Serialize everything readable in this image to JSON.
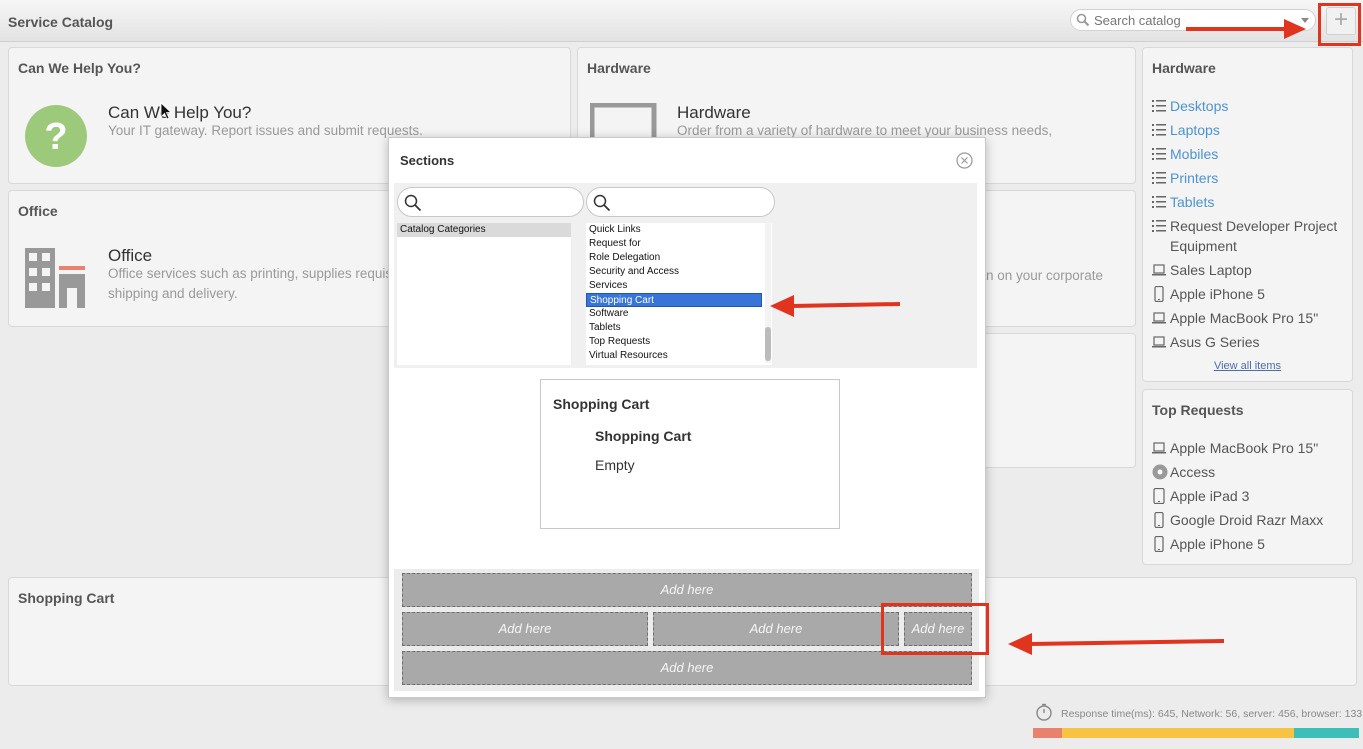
{
  "app": {
    "title": "Service Catalog",
    "search_placeholder": "Search catalog"
  },
  "widgets": {
    "help": {
      "title": "Can We Help You?",
      "heading": "Can We Help You?",
      "desc": "Your IT gateway. Report issues and submit requests."
    },
    "hardware": {
      "title": "Hardware",
      "heading": "Hardware",
      "desc": "Order from a variety of hardware to meet your business needs,"
    },
    "office": {
      "title": "Office",
      "heading": "Office",
      "desc_line1": "Office services such as printing, supplies requis",
      "desc_line2": "shipping and delivery."
    },
    "right_fragment": "n on your corporate",
    "shopping_cart": {
      "title": "Shopping Cart"
    }
  },
  "hardware_side": {
    "title": "Hardware",
    "items": [
      {
        "label": "Desktops",
        "icon": "list-icon",
        "link": true
      },
      {
        "label": "Laptops",
        "icon": "list-icon",
        "link": true
      },
      {
        "label": "Mobiles",
        "icon": "list-icon",
        "link": true
      },
      {
        "label": "Printers",
        "icon": "list-icon",
        "link": true
      },
      {
        "label": "Tablets",
        "icon": "list-icon",
        "link": true
      },
      {
        "label": "Request Developer Project Equipment",
        "icon": "list-icon",
        "link": false
      },
      {
        "label": "Sales Laptop",
        "icon": "laptop-icon",
        "link": false
      },
      {
        "label": "Apple iPhone 5",
        "icon": "phone-icon",
        "link": false
      },
      {
        "label": "Apple MacBook Pro 15\"",
        "icon": "laptop-icon",
        "link": false
      },
      {
        "label": "Asus G Series",
        "icon": "laptop-icon",
        "link": false
      }
    ],
    "view_all": "View all items"
  },
  "top_requests": {
    "title": "Top Requests",
    "items": [
      {
        "label": "Apple MacBook Pro 15\"",
        "icon": "laptop-icon"
      },
      {
        "label": "Access",
        "icon": "disc-icon"
      },
      {
        "label": "Apple iPad 3",
        "icon": "tablet-icon"
      },
      {
        "label": "Google Droid Razr Maxx",
        "icon": "phone-icon"
      },
      {
        "label": "Apple iPhone 5",
        "icon": "phone-icon"
      }
    ]
  },
  "sections_modal": {
    "title": "Sections",
    "left_list": [
      "Catalog Categories"
    ],
    "right_list": [
      "Quick Links",
      "Request for",
      "Role Delegation",
      "Security and Access",
      "Services",
      "Shopping Cart",
      "Software",
      "Tablets",
      "Top Requests",
      "Virtual Resources"
    ],
    "selected": "Shopping Cart",
    "preview": {
      "title": "Shopping Cart",
      "subtitle": "Shopping Cart",
      "empty": "Empty"
    },
    "add_here": "Add here"
  },
  "footer": {
    "response": "Response time(ms): 645, Network: 56, server: 456, browser: 133"
  },
  "colors": {
    "accent_red": "#e0341e",
    "link_blue": "#4b93d0",
    "help_green": "#9dc97b",
    "timing_network": "#e8826e",
    "timing_server": "#f8c343",
    "timing_browser": "#3dbfb9"
  }
}
